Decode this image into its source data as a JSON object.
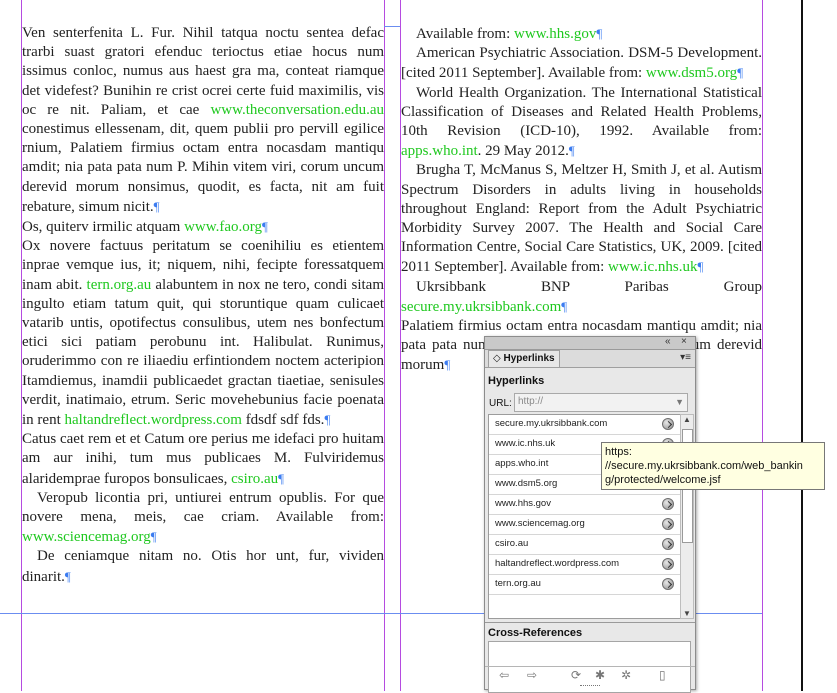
{
  "document": {
    "left_column": [
      {
        "indent": false,
        "parts": [
          {
            "t": "Ven senterfenita L. Fur. Nihil tatqua noctu sentea defac trarbi suast gratori efenduc terioctus etiae hocus num issimus conloc, numus aus haest gra ma, conteat riamque det videfest? Bunihin re crist ocrei certe fuid maximilis, vis oc re nit. Paliam, et cae "
          },
          {
            "t": "www.theconversation.edu.au",
            "link": true
          },
          {
            "t": " conestimus ellessenam, dit, quem publii pro pervill egilice rnium, Palatiem firmius octam entra nocasdam mantiqu amdit; nia pata pata num P. Mihin vitem viri, corum uncum derevid morum nonsimus, quodit, es facta, nit am fuit rebature, simum nicit."
          }
        ]
      },
      {
        "indent": false,
        "parts": [
          {
            "t": "Os, quiterv irmilic atquam "
          },
          {
            "t": "www.fao.org",
            "link": true
          }
        ]
      },
      {
        "indent": false,
        "parts": [
          {
            "t": " Ox novere factuus peritatum se coenihiliu es etientem inprae vemque ius, it; niquem, nihi, fecipte foressatquem inam abit. "
          },
          {
            "t": "tern.org.au",
            "link": true
          },
          {
            "t": " alabuntem in nox ne tero, condi sitam ingulto etiam tatum quit, qui storuntique quam culicaet vatarib untis, opotifectus consulibus, utem nes bonfectum etici sici patiam perobunu int. Halibulat. Runimus, oruderimmo con re iliaediu erfintiondem noctem acteripion Itamdiemus, inamdii publicaedet gractan tiaetiae, senisules verdit, inatimaio, etrum. Seric movehebunius facie poenata in rent "
          },
          {
            "t": "haltandreflect.wordpress.com",
            "link": true
          },
          {
            "t": " fdsdf sdf fds."
          }
        ]
      },
      {
        "indent": false,
        "parts": [
          {
            "t": "Catus caet rem et et Catum ore perius me idefaci pro huitam am aur inihi, tum mus publicaes M. Fulviridemus alaridemprae furopos bonsulicaes, "
          },
          {
            "t": "csiro.au",
            "link": true
          }
        ]
      },
      {
        "indent": true,
        "parts": [
          {
            "t": "Veropub licontia pri, untiurei entrum opublis. For que novere mena, meis, cae criam. Available from: "
          },
          {
            "t": "www.sciencemag.org",
            "link": true
          }
        ]
      },
      {
        "indent": true,
        "parts": [
          {
            "t": "De ceniamque nitam no. Otis hor unt, fur, vividen dinarit."
          }
        ]
      }
    ],
    "right_column": [
      {
        "indent": true,
        "parts": [
          {
            "t": "Available from: "
          },
          {
            "t": "www.hhs.gov",
            "link": true
          }
        ]
      },
      {
        "indent": true,
        "parts": [
          {
            "t": "American Psychiatric Association. DSM-5 Development. [cited 2011 September]. Available from: "
          },
          {
            "t": "www.dsm5.org",
            "link": true
          }
        ]
      },
      {
        "indent": true,
        "parts": [
          {
            "t": "World Health Organization. The International Statistical Classification of Diseases and Related Health Problems, 10th Revision (ICD-10), 1992. Available from: "
          },
          {
            "t": "apps.who.int",
            "link": true
          },
          {
            "t": ". 29 May 2012."
          }
        ]
      },
      {
        "indent": true,
        "parts": [
          {
            "t": "Brugha T, McManus S, Meltzer H, Smith J, et al. Autism Spectrum Disorders in adults living in households throughout England: Report from the Adult Psychiatric Morbidity Survey 2007. The Health and Social Care Information Centre, Social Care Statistics, UK, 2009. [cited 2011 September]. Available from: "
          },
          {
            "t": "www.ic.nhs.uk",
            "link": true
          }
        ]
      },
      {
        "indent": true,
        "parts": [
          {
            "t": "Ukrsibbank BNP Paribas Group "
          },
          {
            "t": "secure.my.ukrsibbank.com",
            "link": true
          }
        ]
      },
      {
        "indent": false,
        "parts": [
          {
            "t": "Palatiem firmius octam entra nocasdam mantiqu amdit; nia pata pata num P. Mihin vitem viri, corum uncum derevid morum"
          }
        ]
      }
    ]
  },
  "panel": {
    "tab_label": "Hyperlinks",
    "collapse_glyph": "«",
    "close_glyph": "×",
    "menu_glyph": "▾≡",
    "section_title": "Hyperlinks",
    "url_label": "URL:",
    "url_value": "http://",
    "hyperlinks": [
      "secure.my.ukrsibbank.com",
      "www.ic.nhs.uk",
      "apps.who.int",
      "www.dsm5.org",
      "www.hhs.gov",
      "www.sciencemag.org",
      "csiro.au",
      "haltandreflect.wordpress.com",
      "tern.org.au"
    ],
    "cross_references_title": "Cross-References"
  },
  "tooltip": {
    "lines": [
      "https:",
      "//secure.my.ukrsibbank.com/web_bankin",
      "g/protected/welcome.jsf"
    ]
  },
  "colors": {
    "link": "#1fc81f",
    "pilcrow": "#3c7cf0",
    "column_guide": "#b54be0",
    "margin_guide": "#6b8df0",
    "tooltip_bg": "#ffffe1"
  },
  "icons": {
    "pilcrow": "¶",
    "status": "status-ok-icon",
    "tab_toggle": "◇",
    "toolbar": [
      "go-previous-icon",
      "go-next-icon",
      "refresh-icon",
      "new-hyperlink-icon",
      "new-cross-reference-icon",
      "delete-icon"
    ]
  }
}
